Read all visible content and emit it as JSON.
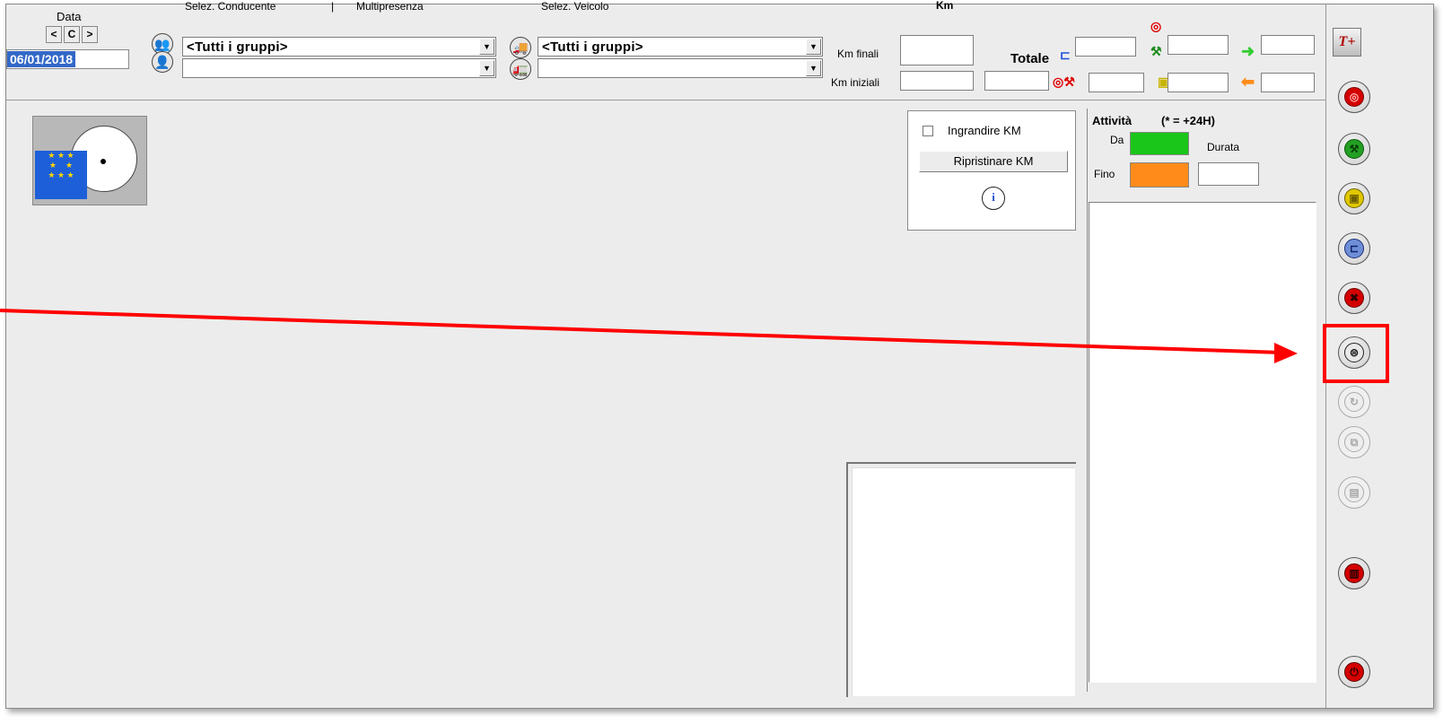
{
  "header": {
    "date_label": "Data",
    "nav_prev": "<",
    "nav_center": "C",
    "nav_next": ">",
    "date_value": "06/01/2018",
    "driver_select_label": "Selez. Conducente",
    "separator": "|",
    "multipresence_label": "Multipresenza",
    "driver_group_value": "<Tutti i gruppi>",
    "driver_value": "",
    "vehicle_select_label": "Selez. Veicolo",
    "vehicle_group_value": "<Tutti i gruppi>",
    "vehicle_value": ""
  },
  "km": {
    "title": "Km",
    "km_final_label": "Km finali",
    "km_initial_label": "Km iniziali",
    "km_final_value": "",
    "km_initial_value": "",
    "km_total_value": ""
  },
  "totals": {
    "label": "Totale"
  },
  "km_panel": {
    "enlarge_label": "Ingrandire KM",
    "enlarge_checked": false,
    "restore_label": "Ripristinare KM",
    "info_icon": "i"
  },
  "activity": {
    "title": "Attività",
    "note": "(* = +24H)",
    "from_label": "Da",
    "duration_label": "Durata",
    "to_label": "Fino",
    "from_color": "#19c619",
    "to_color": "#ff8c1a",
    "duration_value": ""
  },
  "sidebar": {
    "buttons": [
      {
        "name": "tachograph-add-button",
        "icon": "T+"
      },
      {
        "name": "driving-button",
        "icon": "⊙"
      },
      {
        "name": "work-button",
        "icon": "✖"
      },
      {
        "name": "availability-button",
        "icon": "▣"
      },
      {
        "name": "rest-button",
        "icon": "⊏"
      },
      {
        "name": "other-work-button",
        "icon": "✖"
      },
      {
        "name": "print-button",
        "icon": "⊜"
      },
      {
        "name": "refresh-button",
        "icon": "↻"
      },
      {
        "name": "copy-button",
        "icon": "⧉"
      },
      {
        "name": "save-button",
        "icon": "▤"
      },
      {
        "name": "delete-button",
        "icon": "🗑"
      },
      {
        "name": "power-button",
        "icon": "⏻"
      }
    ]
  },
  "colors": {
    "highlight_box": "#ff0000",
    "arrow": "#ff0000",
    "eu_flag": "#1d5fd8",
    "eu_stars": "#ffd700"
  }
}
